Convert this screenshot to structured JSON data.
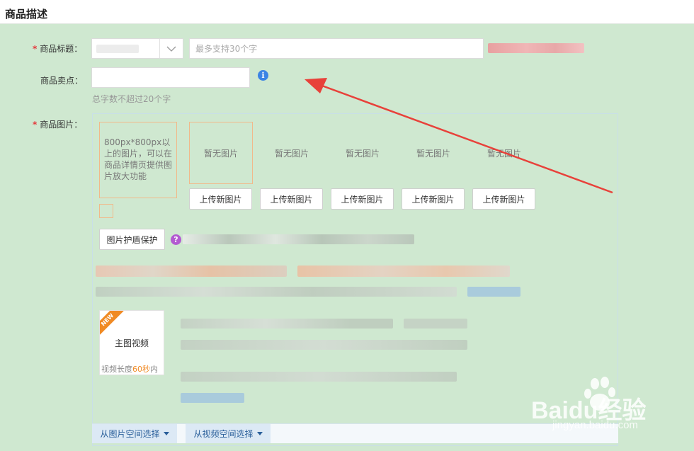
{
  "header": {
    "title": "商品描述"
  },
  "title_row": {
    "required_mark": "*",
    "label": "商品标题：",
    "placeholder": "最多支持30个字"
  },
  "selling_point_row": {
    "label": "商品卖点：",
    "info_icon": "i",
    "hint": "总字数不超过20个字"
  },
  "images_row": {
    "required_mark": "*",
    "label": "商品图片：",
    "main_slot_text": "800px*800px以上的图片，可以在商品详情页提供图片放大功能",
    "slots": [
      {
        "empty_text": "暂无图片",
        "upload_label": "上传新图片"
      },
      {
        "empty_text": "暂无图片",
        "upload_label": "上传新图片"
      },
      {
        "empty_text": "暂无图片",
        "upload_label": "上传新图片"
      },
      {
        "empty_text": "暂无图片",
        "upload_label": "上传新图片"
      },
      {
        "empty_text": "暂无图片",
        "upload_label": "上传新图片"
      }
    ],
    "protect_button": "图片护盾保护",
    "help_icon": "?"
  },
  "video": {
    "badge": "NEW",
    "title": "主图视频",
    "length_prefix": "视频长度",
    "length_value": "60秒",
    "length_suffix": "内"
  },
  "bottom_bar": {
    "pick_image_space": "从图片空间选择",
    "pick_video_space": "从视频空间选择"
  },
  "watermark": {
    "brand": "Baidu经验",
    "url": "jingyan.baidu.com"
  },
  "colors": {
    "background": "#cfe8d0",
    "required": "#e4393c",
    "accent_orange": "#f08a24",
    "info_blue": "#3b84e4",
    "arrow_red": "#e8413a"
  }
}
